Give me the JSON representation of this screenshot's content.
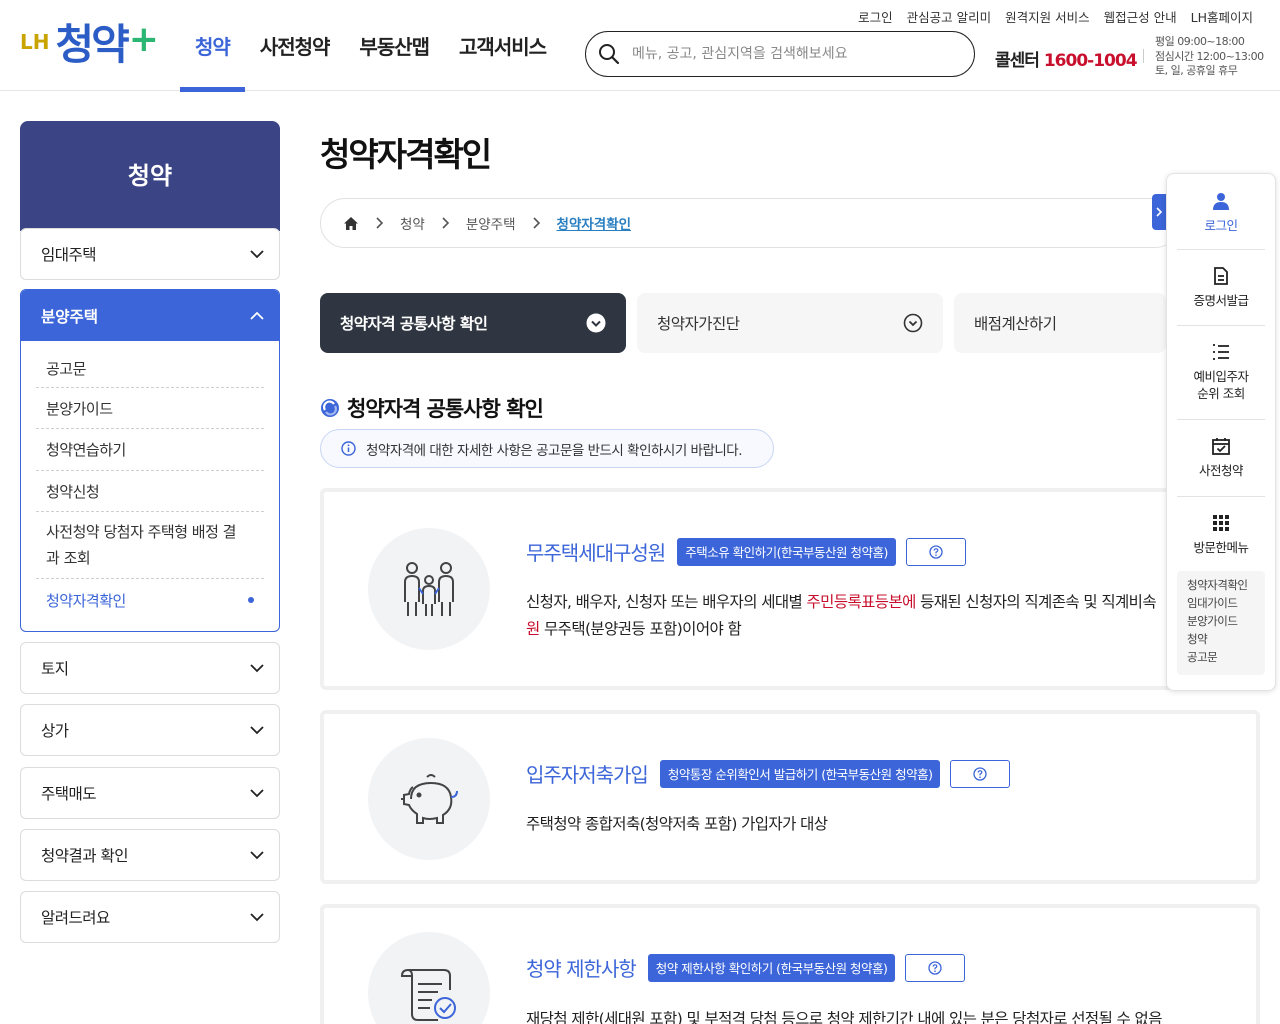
{
  "header": {
    "logo_prefix": "LH",
    "logo_main": "청약",
    "logo_plus": "+",
    "gnb": [
      "청약",
      "사전청약",
      "부동산맵",
      "고객서비스"
    ],
    "util_links": [
      "로그인",
      "관심공고 알리미",
      "원격지원 서비스",
      "웹접근성 안내",
      "LH홈페이지"
    ],
    "search_placeholder": "메뉴, 공고, 관심지역을 검색해보세요",
    "callcenter_label": "콜센터",
    "callcenter_number": "1600-1004",
    "hours": [
      "평일 09:00~18:00",
      "점심시간 12:00~13:00",
      "토, 일, 공휴일 휴무"
    ]
  },
  "sidebar": {
    "title": "청약",
    "rental": "임대주택",
    "sale": "분양주택",
    "sub_items": [
      "공고문",
      "분양가이드",
      "청약연습하기",
      "청약신청",
      "사전청약 당첨자 주택형 배정 결과 조회",
      "청약자격확인"
    ],
    "others": [
      "토지",
      "상가",
      "주택매도",
      "청약결과 확인",
      "알려드려요"
    ]
  },
  "main": {
    "title": "청약자격확인",
    "breadcrumb": [
      "청약",
      "분양주택",
      "청약자격확인"
    ],
    "tabs": [
      "청약자격 공통사항 확인",
      "청약자가진단",
      "배점계산하기"
    ],
    "section_title": "청약자격 공통사항 확인",
    "notice": "청약자격에 대한 자세한 사항은 공고문을 반드시 확인하시기 바랍니다.",
    "cards": [
      {
        "title": "무주택세대구성원",
        "link": "주택소유 확인하기(한국부동산원 청약홈)",
        "desc_line1_a": "신청자, 배우자, 신청자 또는 배우자의 세대별 ",
        "desc_line1_hl": "주민등록표등본에",
        "desc_line1_b": " 등재된 신청자의 직계존속 및 직계비속",
        "desc_line2_hl": "원",
        "desc_line2_b": " 무주택(분양권등 포함)이어야 함"
      },
      {
        "title": "입주자저축가입",
        "link": "청약통장 순위확인서 발급하기 (한국부동산원 청약홈)",
        "desc": "주택청약 종합저축(청약저축 포함) 가입자가 대상"
      },
      {
        "title": "청약 제한사항",
        "link": "청약 제한사항 확인하기 (한국부동산원 청약홈)",
        "desc": "재당첨 제한(세대원 포함) 및 부적격 당첨 등으로 청약 제한기간 내에 있는 분은 당첨자로 선정될 수 없음"
      }
    ]
  },
  "quick_menu": {
    "login": "로그인",
    "certificate": "증명서발급",
    "ranking_line1": "예비입주자",
    "ranking_line2": "순위 조회",
    "pre_sale": "사전청약",
    "visited": "방문한메뉴",
    "recent": [
      "청약자격확인",
      "임대가이드",
      "분양가이드",
      "청약",
      "공고문"
    ]
  },
  "colors": {
    "brand_blue": "#3b65d8",
    "sidebar_navy": "#3b4484",
    "highlight_red": "#c8102e",
    "dark_tab": "#2f3641"
  }
}
